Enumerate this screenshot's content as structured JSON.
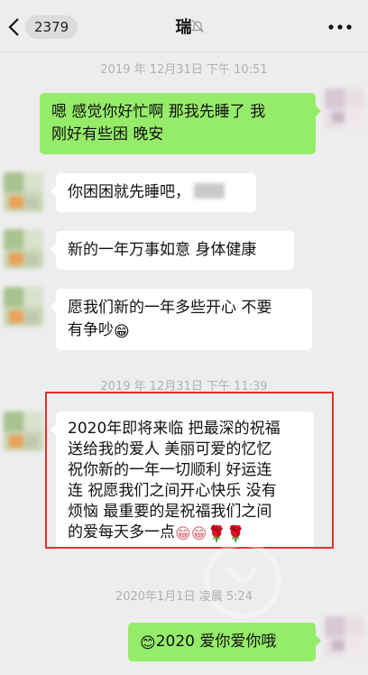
{
  "header": {
    "back_icon": "chevron-left-icon",
    "unread_count": "2379",
    "title": "瑞",
    "mute_icon": "bell-off-icon",
    "more_icon": "more-horizontal-icon"
  },
  "timestamps": [
    "2019 年 12月31日 下午 10:51",
    "2019 年 12月31日 下午 11:39",
    "2020年1月1日 凌晨 5:24"
  ],
  "messages": [
    {
      "side": "out",
      "lines": [
        "嗯 感觉你好忙啊 那我先睡了 我",
        "刚好有些困 晚安"
      ]
    },
    {
      "side": "in",
      "text": "你困困就先睡吧，"
    },
    {
      "side": "in",
      "text": "新的一年万事如意 身体健康"
    },
    {
      "side": "in",
      "lines": [
        "愿我们新的一年多些开心 不要",
        "有争吵"
      ],
      "emoji": "😁"
    },
    {
      "side": "in",
      "lines": [
        "2020年即将来临 把最深的祝福",
        "送给我的爱人 美丽可爱的忆忆",
        "祝你新的一年一切顺利 好运连",
        "连 祝愿我们之间开心快乐 没有",
        "烦恼 最重要的是祝福我们之间",
        "的爱每天多一点"
      ],
      "emoji": "😁😁🌹🌹"
    },
    {
      "side": "out",
      "text": "2020 爱你爱你哦",
      "emoji": "😊"
    }
  ],
  "colors": {
    "background": "#ededed",
    "outgoing_bubble": "#95ec69",
    "incoming_bubble": "#ffffff",
    "highlight": "#e03030"
  }
}
